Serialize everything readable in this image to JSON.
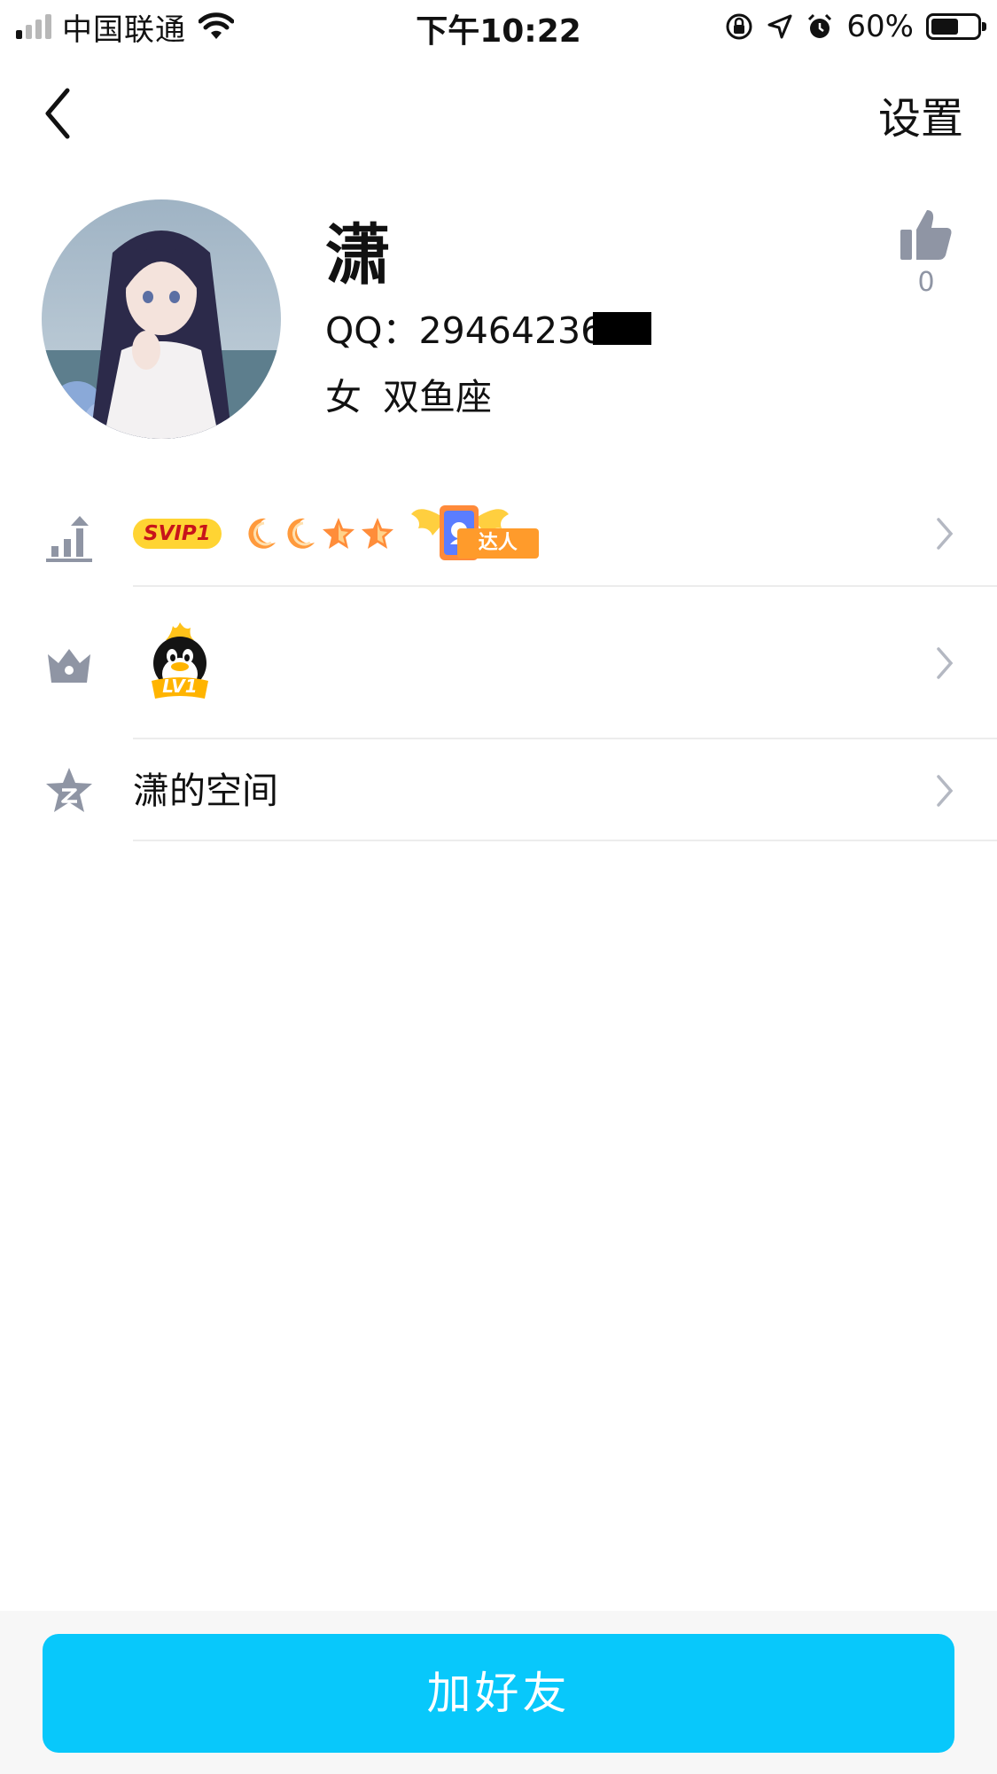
{
  "status_bar": {
    "carrier": "中国联通",
    "time": "下午10:22",
    "battery_percent": "60%",
    "battery_level": 0.6,
    "signal_bars_active": 1,
    "signal_bars_total": 4
  },
  "nav": {
    "back_icon": "chevron-left-icon",
    "settings_label": "设置"
  },
  "profile": {
    "name": "潇",
    "qq_prefix": "QQ：",
    "qq_number_visible": "29464236",
    "gender": "女",
    "zodiac": "双鱼座",
    "like_count": "0",
    "like_icon": "thumbs-up-icon"
  },
  "badges": {
    "svip_label": "SVIP1",
    "level_icons": [
      "moon",
      "moon",
      "star",
      "star"
    ],
    "daren_label": "达人",
    "penguin_level_label": "LV1"
  },
  "list": {
    "row1_icon": "level-up-icon",
    "row2_icon": "crown-icon",
    "row3_icon": "qzone-star-icon",
    "space_label": "潇的空间"
  },
  "bottom": {
    "add_friend_label": "加好友"
  },
  "colors": {
    "accent": "#08c8fb",
    "icon_gray": "#8f95a4",
    "svip_bg": "#ffd433",
    "svip_text": "#c8141b",
    "daren_orange": "#ff9b2b"
  }
}
